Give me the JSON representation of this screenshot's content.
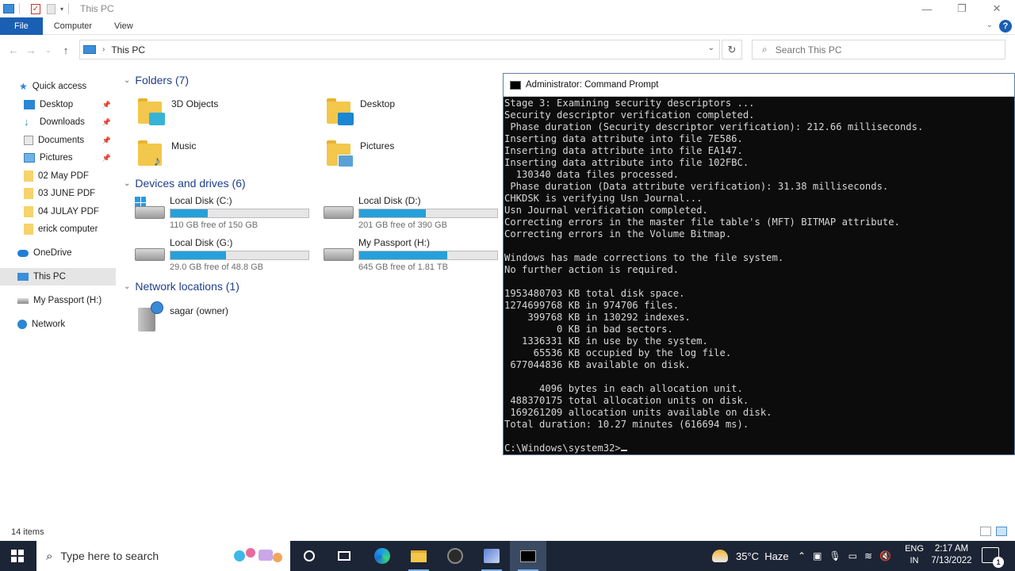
{
  "explorer": {
    "window_title": "This PC",
    "ribbon_tabs": [
      "File",
      "Computer",
      "View"
    ],
    "address_crumb": "This PC",
    "search_placeholder": "Search This PC",
    "nav": [
      {
        "label": "Quick access",
        "icon": "star-icon"
      },
      {
        "label": "Desktop",
        "icon": "desktop-icon",
        "pinned": true
      },
      {
        "label": "Downloads",
        "icon": "download-icon",
        "pinned": true
      },
      {
        "label": "Documents",
        "icon": "documents-icon",
        "pinned": true
      },
      {
        "label": "Pictures",
        "icon": "pictures-icon",
        "pinned": true
      },
      {
        "label": "02 May PDF",
        "icon": "folder-icon"
      },
      {
        "label": "03 JUNE PDF",
        "icon": "folder-icon"
      },
      {
        "label": "04 JULAY PDF",
        "icon": "folder-icon"
      },
      {
        "label": "erick computer",
        "icon": "folder-icon"
      },
      {
        "label": "OneDrive",
        "icon": "cloud-icon"
      },
      {
        "label": "This PC",
        "icon": "pc-icon",
        "selected": true
      },
      {
        "label": "My Passport (H:)",
        "icon": "drive-icon"
      },
      {
        "label": "Network",
        "icon": "network-icon"
      }
    ],
    "groups": {
      "folders": "Folders (7)",
      "drives": "Devices and drives (6)",
      "network": "Network locations (1)"
    },
    "folders": [
      {
        "name": "3D Objects",
        "badge_color": "#37b3d8"
      },
      {
        "name": "Desktop",
        "badge_color": "#1b86d4"
      },
      {
        "name": "Music",
        "badge_color": "#1b6fc2"
      },
      {
        "name": "Pictures",
        "badge_color": "#5aa1d6"
      }
    ],
    "drives": [
      {
        "name": "Local Disk (C:)",
        "free": "110 GB free of 150 GB",
        "used_fraction": 0.27,
        "windows": true
      },
      {
        "name": "Local Disk (D:)",
        "free": "201 GB free of 390 GB",
        "used_fraction": 0.48
      },
      {
        "name": "Local Disk (G:)",
        "free": "29.0 GB free of 48.8 GB",
        "used_fraction": 0.4
      },
      {
        "name": "My Passport (H:)",
        "free": "645 GB free of 1.81 TB",
        "used_fraction": 0.64
      }
    ],
    "network_location": "sagar (owner)",
    "status": "14 items"
  },
  "cmd": {
    "title": "Administrator: Command Prompt",
    "lines": [
      "Stage 3: Examining security descriptors ...",
      "Security descriptor verification completed.",
      " Phase duration (Security descriptor verification): 212.66 milliseconds.",
      "Inserting data attribute into file 7E586.",
      "Inserting data attribute into file EA147.",
      "Inserting data attribute into file 102FBC.",
      "  130340 data files processed.",
      " Phase duration (Data attribute verification): 31.38 milliseconds.",
      "CHKDSK is verifying Usn Journal...",
      "Usn Journal verification completed.",
      "Correcting errors in the master file table's (MFT) BITMAP attribute.",
      "Correcting errors in the Volume Bitmap.",
      "",
      "Windows has made corrections to the file system.",
      "No further action is required.",
      "",
      "1953480703 KB total disk space.",
      "1274699768 KB in 974706 files.",
      "    399768 KB in 130292 indexes.",
      "         0 KB in bad sectors.",
      "   1336331 KB in use by the system.",
      "     65536 KB occupied by the log file.",
      " 677044836 KB available on disk.",
      "",
      "      4096 bytes in each allocation unit.",
      " 488370175 total allocation units on disk.",
      " 169261209 allocation units available on disk.",
      "Total duration: 10.27 minutes (616694 ms).",
      "",
      "C:\\Windows\\system32>"
    ]
  },
  "taskbar": {
    "search_placeholder": "Type here to search",
    "weather": "35°C  Haze",
    "lang_top": "ENG",
    "lang_bottom": "IN",
    "time": "2:17 AM",
    "date": "7/13/2022",
    "notification_count": "1"
  }
}
